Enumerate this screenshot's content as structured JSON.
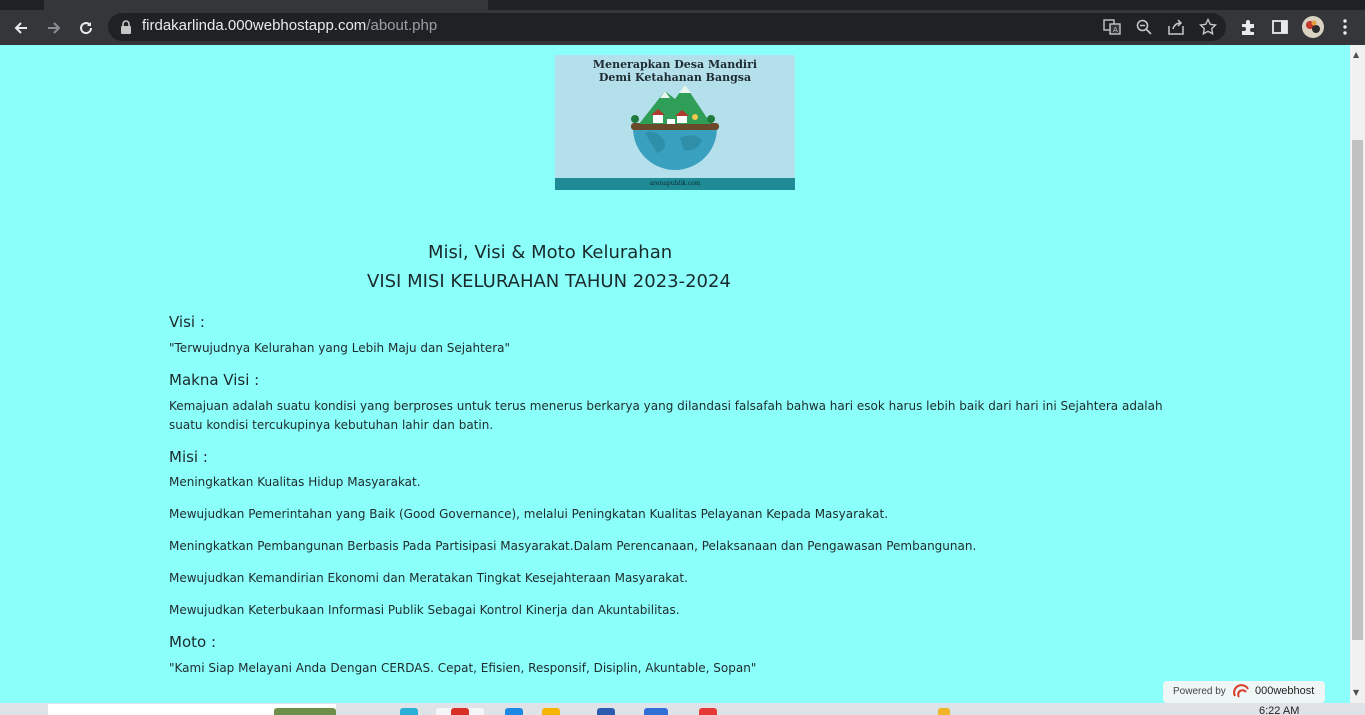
{
  "browser": {
    "url_host": "firdakarlinda.000webhostapp.com",
    "url_path": "/about.php"
  },
  "banner": {
    "title_line1": "Menerapkan Desa Mandiri",
    "title_line2": "Demi Ketahanan Bangsa",
    "footer": "arenapublik.com"
  },
  "heading": {
    "line1": "Misi, Visi & Moto Kelurahan",
    "line2": "VISI MISI KELURAHAN TAHUN 2023-2024"
  },
  "visi": {
    "label": "Visi :",
    "text": "\"Terwujudnya Kelurahan yang Lebih Maju dan Sejahtera\""
  },
  "makna_visi": {
    "label": "Makna Visi :",
    "text": "Kemajuan adalah suatu kondisi yang berproses untuk terus menerus berkarya yang dilandasi falsafah bahwa hari esok harus lebih baik dari hari ini Sejahtera adalah suatu kondisi tercukupinya kebutuhan lahir dan batin."
  },
  "misi": {
    "label": "Misi :",
    "items": [
      "Meningkatkan Kualitas Hidup Masyarakat.",
      "Mewujudkan Pemerintahan yang Baik (Good Governance), melalui Peningkatan Kualitas Pelayanan Kepada Masyarakat.",
      "Meningkatkan Pembangunan Berbasis Pada Partisipasi Masyarakat.Dalam Perencanaan, Pelaksanaan dan Pengawasan Pembangunan.",
      "Mewujudkan Kemandirian Ekonomi dan Meratakan Tingkat Kesejahteraan Masyarakat.",
      "Mewujudkan Keterbukaan Informasi Publik Sebagai Kontrol Kinerja dan Akuntabilitas."
    ]
  },
  "moto": {
    "label": "Moto :",
    "text": "\"Kami Siap Melayani Anda Dengan CERDAS. Cepat, Efisien, Responsif, Disiplin, Akuntable, Sopan\""
  },
  "powered": {
    "label": "Powered by",
    "brand": "000webhost"
  },
  "taskbar": {
    "clock": "6:22 AM"
  },
  "colors": {
    "page_background": "#8bfffa",
    "chrome_dark": "#35363a"
  },
  "icons": [
    "back-arrow-icon",
    "forward-arrow-icon",
    "reload-icon",
    "lock-icon",
    "translate-icon",
    "zoom-icon",
    "share-icon",
    "star-icon",
    "extensions-icon",
    "side-panel-icon",
    "profile-avatar",
    "kebab-menu-icon"
  ]
}
